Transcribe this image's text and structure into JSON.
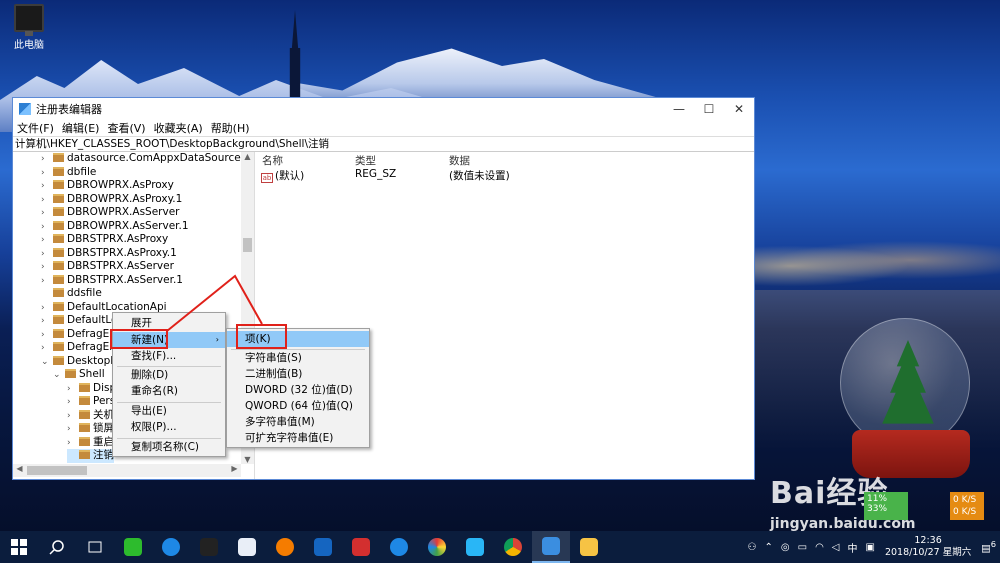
{
  "desktop": {
    "this_pc_label": "此电脑"
  },
  "window": {
    "title": "注册表编辑器",
    "menu": [
      "文件(F)",
      "编辑(E)",
      "查看(V)",
      "收藏夹(A)",
      "帮助(H)"
    ],
    "address": "计算机\\HKEY_CLASSES_ROOT\\DesktopBackground\\Shell\\注销",
    "minimize_glyph": "—",
    "maximize_glyph": "☐",
    "close_glyph": "✕"
  },
  "tree": [
    {
      "label": "datasource.ComAppxDataSourceFacto",
      "expanded": false
    },
    {
      "label": "dbfile",
      "expanded": false
    },
    {
      "label": "DBROWPRX.AsProxy",
      "expanded": false
    },
    {
      "label": "DBROWPRX.AsProxy.1",
      "expanded": false
    },
    {
      "label": "DBROWPRX.AsServer",
      "expanded": false
    },
    {
      "label": "DBROWPRX.AsServer.1",
      "expanded": false
    },
    {
      "label": "DBRSTPRX.AsProxy",
      "expanded": false
    },
    {
      "label": "DBRSTPRX.AsProxy.1",
      "expanded": false
    },
    {
      "label": "DBRSTPRX.AsServer",
      "expanded": false
    },
    {
      "label": "DBRSTPRX.AsServer.1",
      "expanded": false
    },
    {
      "label": "ddsfile",
      "expanded": false
    },
    {
      "label": "DefaultLocationApi",
      "expanded": false
    },
    {
      "label": "DefaultLo",
      "expanded": false
    },
    {
      "label": "DefragEn",
      "expanded": false
    },
    {
      "label": "DefragEn",
      "expanded": false
    },
    {
      "label": "DesktopE",
      "expanded": true
    },
    {
      "label": "Shell",
      "expanded": true
    },
    {
      "label": "Disp",
      "expanded": false
    },
    {
      "label": "Pers",
      "expanded": false
    },
    {
      "label": "关机",
      "expanded": false
    },
    {
      "label": "锁屏",
      "expanded": false
    },
    {
      "label": "重启",
      "expanded": false
    },
    {
      "label": "注销",
      "expanded": false
    }
  ],
  "list": {
    "headers": {
      "name": "名称",
      "type": "类型",
      "data": "数据"
    },
    "rows": [
      {
        "name": "(默认)",
        "type": "REG_SZ",
        "data": "(数值未设置)",
        "icon": "ab"
      }
    ]
  },
  "context_menu": {
    "items": [
      "展开",
      "新建(N)",
      "查找(F)...",
      "删除(D)",
      "重命名(R)",
      "导出(E)",
      "权限(P)...",
      "复制项名称(C)"
    ],
    "submenu_arrow": "›"
  },
  "submenu": {
    "items": [
      "项(K)",
      "字符串值(S)",
      "二进制值(B)",
      "DWORD (32 位)值(D)",
      "QWORD (64 位)值(Q)",
      "多字符串值(M)",
      "可扩充字符串值(E)"
    ]
  },
  "watermark": {
    "logo": "Bai经验",
    "url": "jingyan.baidu.com"
  },
  "net_widget": {
    "pct1": "11%",
    "pct2": "33%",
    "up": "0 K/S",
    "down": "0 K/S"
  },
  "taskbar": {
    "ime": "中",
    "time": "12:36",
    "date": "2018/10/27 星期六",
    "notification_count": "6"
  },
  "colors": {
    "highlight": "#91c9f7",
    "annotation_red": "#e0211a",
    "taskbar": "#0b1d3d"
  }
}
